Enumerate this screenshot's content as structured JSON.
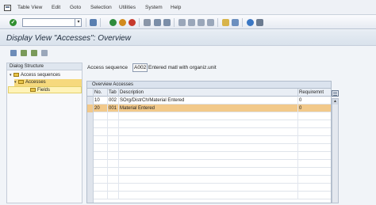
{
  "menubar": {
    "items": [
      "Table View",
      "Edit",
      "Goto",
      "Selection",
      "Utilities",
      "System",
      "Help"
    ]
  },
  "toolbar": {
    "command_field": ""
  },
  "title": "Display View \"Accesses\": Overview",
  "dialog_structure": {
    "heading": "Dialog Structure",
    "items": [
      {
        "label": "Access sequences"
      },
      {
        "label": "Accesses"
      },
      {
        "label": "Fields"
      }
    ]
  },
  "access_sequence": {
    "label": "Access sequence",
    "value": "A002",
    "description": "Entered matl with organiz.unit"
  },
  "table": {
    "caption": "Overview Accesses",
    "columns": [
      "No.",
      "Tab",
      "Description",
      "Requiremnt"
    ],
    "rows": [
      {
        "no": "10",
        "tab": "002",
        "description": "SOrg/DistrCh/Material Entered",
        "req": "0"
      },
      {
        "no": "20",
        "tab": "001",
        "description": "Material Entered",
        "req": "0"
      }
    ]
  },
  "colors": {
    "selected_row": "#f2c98a",
    "tree_selected": "#fff3b8"
  }
}
